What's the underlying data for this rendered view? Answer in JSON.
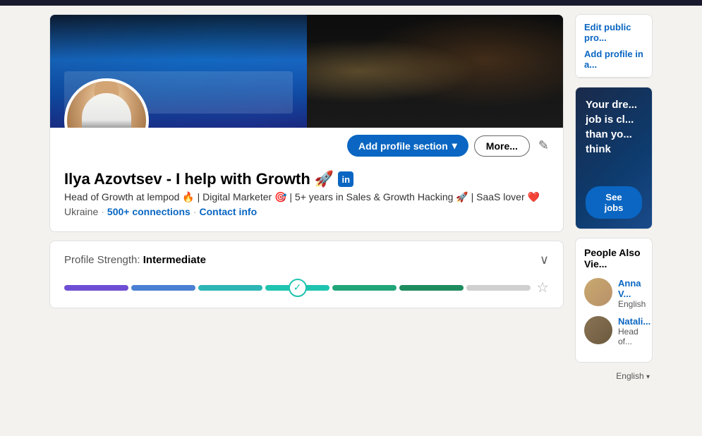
{
  "topBar": {
    "color": "#1a1a2e"
  },
  "profile": {
    "name": "Ilya Azovtsev - I help with Growth 🚀",
    "linkedinBadge": "in",
    "headline": "Head of Growth at lempod 🔥 | Digital Marketer 🎯 | 5+ years in Sales & Growth Hacking 🚀 | SaaS lover ❤️",
    "location": "Ukraine",
    "connections": "500+ connections",
    "contactInfo": "Contact info",
    "actions": {
      "addProfileSection": "Add profile section",
      "more": "More...",
      "editIcon": "✏️"
    }
  },
  "profileStrength": {
    "label": "Profile Strength:",
    "level": "Intermediate"
  },
  "rightSidebar": {
    "editPublicProfile": "Edit public pro...",
    "addProfileIn": "Add profile in a...",
    "ad": {
      "text": "Your dre... job is cl... than yo... think",
      "button": "See jobs"
    },
    "peopleAlsoViewed": {
      "title": "People Also Vie...",
      "people": [
        {
          "name": "Anna V...",
          "role": "English"
        },
        {
          "name": "Natali...",
          "role": "Head of..."
        },
        {
          "name": "...",
          "role": "..."
        }
      ]
    },
    "language": "English"
  },
  "icons": {
    "chevronDown": "▾",
    "pencil": "✎",
    "check": "✓",
    "star": "☆"
  }
}
